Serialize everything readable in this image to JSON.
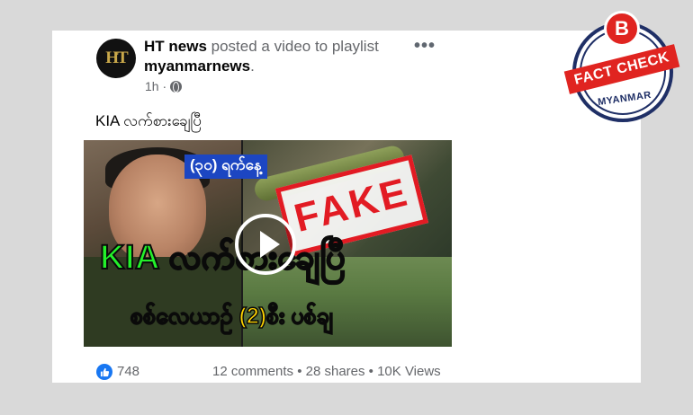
{
  "post": {
    "author": "HT news",
    "action": "posted a video to playlist",
    "playlist": "myanmarnews",
    "playlist_suffix": ".",
    "time": "1h ·",
    "avatar_text": "HT",
    "more_label": "•••",
    "text": "KIA လက်စားချေပြီ"
  },
  "video": {
    "date_caption": "(၃၀) ရက်နေ့",
    "headline": "KIA လက်စားချေပြီ",
    "subline": "စစ်လေယာဉ် (2)စီး ပစ်ချ",
    "stamp": "FAKE"
  },
  "footer": {
    "likes": "748",
    "stats": "12 comments • 28 shares • 10K Views"
  },
  "badge": {
    "letter": "B",
    "banner": "FACT CHECK",
    "country": "MYANMAR"
  },
  "colors": {
    "like_blue": "#1877f2",
    "fake_red": "#e21b23",
    "badge_navy": "#1f2f66",
    "headline_green": "#23f02a",
    "subline_yellow": "#ffd400"
  },
  "icons": [
    "globe-icon",
    "more-options-icon",
    "like-icon",
    "play-icon"
  ]
}
